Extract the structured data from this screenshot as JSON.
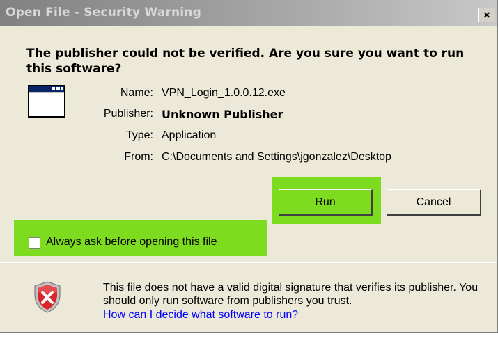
{
  "window": {
    "title": "Open File - Security Warning",
    "close_label": "×"
  },
  "question": "The publisher could not be verified.  Are you sure you want to run this software?",
  "file_info": {
    "name_label": "Name:",
    "name_value": "VPN_Login_1.0.0.12.exe",
    "publisher_label": "Publisher:",
    "publisher_value": "Unknown Publisher",
    "type_label": "Type:",
    "type_value": "Application",
    "from_label": "From:",
    "from_value": "C:\\Documents and Settings\\jgonzalez\\Desktop"
  },
  "buttons": {
    "run": "Run",
    "cancel": "Cancel"
  },
  "checkbox": {
    "label": "Always ask before opening this file",
    "checked": false
  },
  "warning": {
    "text": "This file does not have a valid digital signature that verifies its publisher.  You should only run software from publishers you trust.",
    "link": "How can I decide what software to run?"
  },
  "colors": {
    "highlight": "#7ddc1f",
    "dialog_bg": "#ece9d8",
    "titlebar": "#a9a9a9",
    "link": "#0000ff",
    "shield_red": "#d8262c"
  },
  "icons": {
    "app": "application-window-icon",
    "shield": "security-shield-x-icon"
  }
}
